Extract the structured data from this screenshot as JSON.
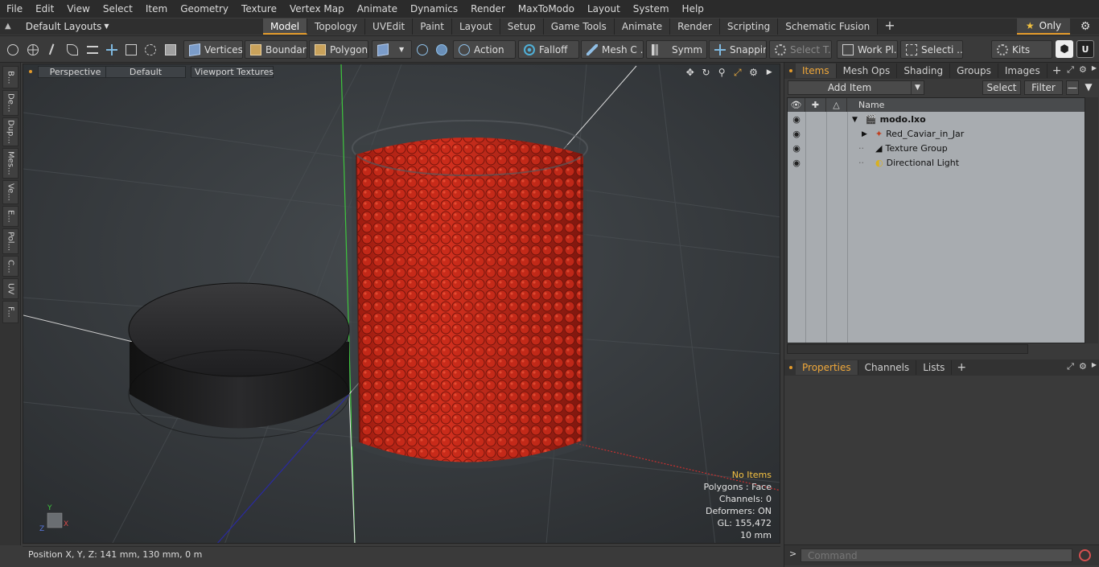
{
  "menu": [
    "File",
    "Edit",
    "View",
    "Select",
    "Item",
    "Geometry",
    "Texture",
    "Vertex Map",
    "Animate",
    "Dynamics",
    "Render",
    "MaxToModo",
    "Layout",
    "System",
    "Help"
  ],
  "layout_selector": {
    "label": "Default Layouts"
  },
  "layout_tabs": [
    {
      "label": "Model",
      "active": true
    },
    {
      "label": "Topology"
    },
    {
      "label": "UVEdit"
    },
    {
      "label": "Paint"
    },
    {
      "label": "Layout"
    },
    {
      "label": "Setup"
    },
    {
      "label": "Game Tools"
    },
    {
      "label": "Animate"
    },
    {
      "label": "Render"
    },
    {
      "label": "Scripting"
    },
    {
      "label": "Schematic Fusion"
    }
  ],
  "only_button": "Only",
  "toolbar": {
    "vertices": "Vertices",
    "boundary": "Boundary",
    "polygons": "Polygons",
    "action": "Action",
    "falloff": "Falloff",
    "mesh": "Mesh C ...",
    "symmetry": "Symm ...",
    "snapping": "Snapping",
    "select_t": "Select T...",
    "work_plane": "Work Pl...",
    "selection": "Selecti ...",
    "kits": "Kits"
  },
  "left_tabs": [
    "B...",
    "De...",
    "Dup...",
    "Mes...",
    "Ve...",
    "E...",
    "Pol...",
    "C...",
    "UV",
    "F..."
  ],
  "viewport": {
    "view": "Perspective",
    "shading": "Default",
    "textures": "Viewport Textures",
    "info": {
      "selection": "No Items",
      "polygons": "Polygons : Face",
      "channels": "Channels: 0",
      "deformers": "Deformers: ON",
      "gl": "GL: 155,472",
      "scale": "10 mm"
    }
  },
  "status": {
    "position": "Position X, Y, Z:   141 mm, 130 mm, 0 m"
  },
  "items_panel": {
    "tabs": [
      {
        "label": "Items",
        "active": true
      },
      {
        "label": "Mesh Ops"
      },
      {
        "label": "Shading"
      },
      {
        "label": "Groups"
      },
      {
        "label": "Images"
      }
    ],
    "add_item": "Add Item",
    "select": "Select",
    "filter": "Filter",
    "column_name": "Name",
    "items": [
      {
        "label": "modo.lxo",
        "icon": "scene-icon",
        "bold": true
      },
      {
        "label": "Red_Caviar_in_Jar",
        "icon": "mesh-icon"
      },
      {
        "label": "Texture Group",
        "icon": "texture-group-icon"
      },
      {
        "label": "Directional Light",
        "icon": "light-icon"
      }
    ]
  },
  "props_panel": {
    "tabs": [
      {
        "label": "Properties",
        "active": true
      },
      {
        "label": "Channels"
      },
      {
        "label": "Lists"
      }
    ]
  },
  "command": {
    "placeholder": "Command"
  },
  "colors": {
    "accent": "#e39a2b",
    "caviar": "#c8281a",
    "viewport_bg": "#2e3235"
  }
}
